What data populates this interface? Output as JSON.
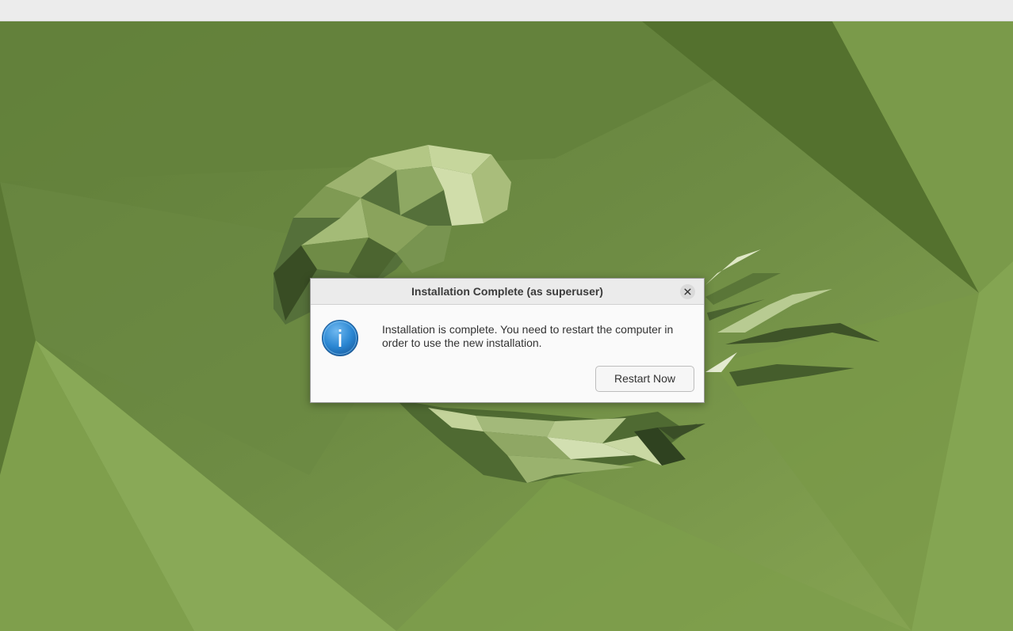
{
  "dialog": {
    "title": "Installation Complete (as superuser)",
    "message": "Installation is complete. You need to restart the computer in order to use the new installation.",
    "restart_label": "Restart Now",
    "icon": "info-icon",
    "close_icon": "close-icon"
  },
  "colors": {
    "wallpaper_base": "#6c8a42",
    "topbar": "#ececec",
    "info_icon_blue": "#2a86d2",
    "dialog_bg": "#fafafa"
  }
}
